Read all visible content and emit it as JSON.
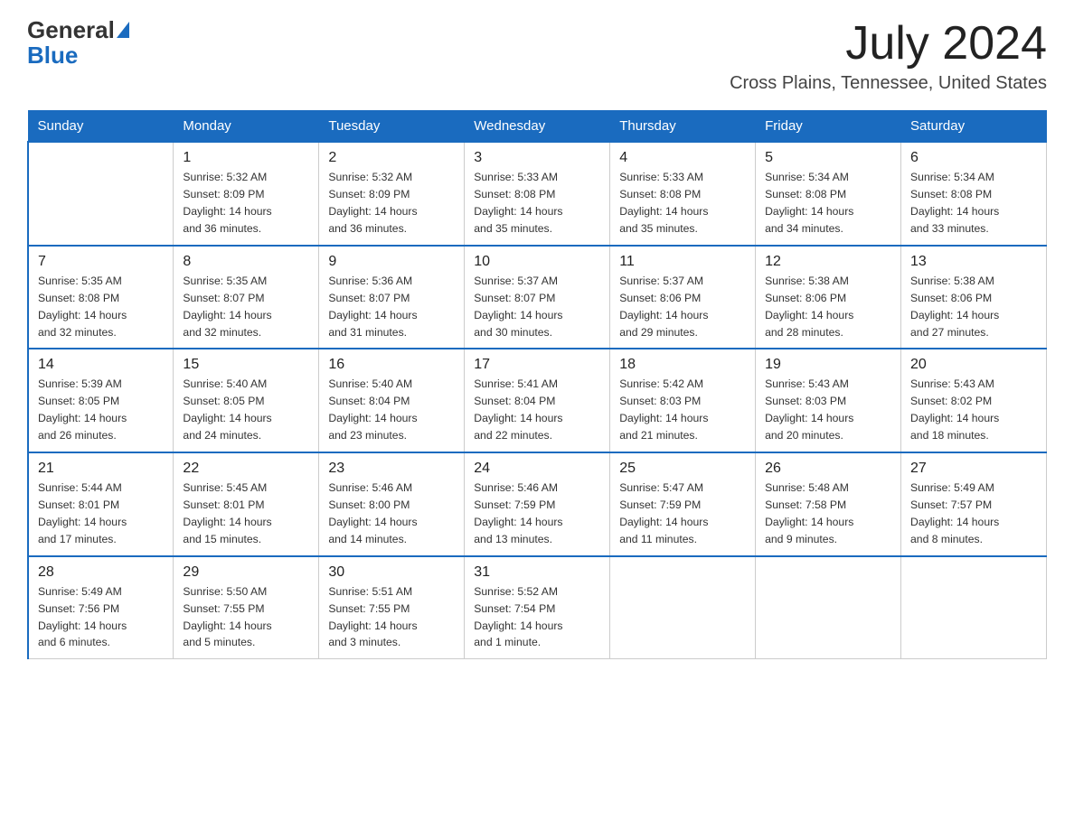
{
  "header": {
    "logo_general": "General",
    "logo_blue": "Blue",
    "month_title": "July 2024",
    "location": "Cross Plains, Tennessee, United States"
  },
  "days_of_week": [
    "Sunday",
    "Monday",
    "Tuesday",
    "Wednesday",
    "Thursday",
    "Friday",
    "Saturday"
  ],
  "weeks": [
    [
      {
        "day": "",
        "info": ""
      },
      {
        "day": "1",
        "info": "Sunrise: 5:32 AM\nSunset: 8:09 PM\nDaylight: 14 hours\nand 36 minutes."
      },
      {
        "day": "2",
        "info": "Sunrise: 5:32 AM\nSunset: 8:09 PM\nDaylight: 14 hours\nand 36 minutes."
      },
      {
        "day": "3",
        "info": "Sunrise: 5:33 AM\nSunset: 8:08 PM\nDaylight: 14 hours\nand 35 minutes."
      },
      {
        "day": "4",
        "info": "Sunrise: 5:33 AM\nSunset: 8:08 PM\nDaylight: 14 hours\nand 35 minutes."
      },
      {
        "day": "5",
        "info": "Sunrise: 5:34 AM\nSunset: 8:08 PM\nDaylight: 14 hours\nand 34 minutes."
      },
      {
        "day": "6",
        "info": "Sunrise: 5:34 AM\nSunset: 8:08 PM\nDaylight: 14 hours\nand 33 minutes."
      }
    ],
    [
      {
        "day": "7",
        "info": "Sunrise: 5:35 AM\nSunset: 8:08 PM\nDaylight: 14 hours\nand 32 minutes."
      },
      {
        "day": "8",
        "info": "Sunrise: 5:35 AM\nSunset: 8:07 PM\nDaylight: 14 hours\nand 32 minutes."
      },
      {
        "day": "9",
        "info": "Sunrise: 5:36 AM\nSunset: 8:07 PM\nDaylight: 14 hours\nand 31 minutes."
      },
      {
        "day": "10",
        "info": "Sunrise: 5:37 AM\nSunset: 8:07 PM\nDaylight: 14 hours\nand 30 minutes."
      },
      {
        "day": "11",
        "info": "Sunrise: 5:37 AM\nSunset: 8:06 PM\nDaylight: 14 hours\nand 29 minutes."
      },
      {
        "day": "12",
        "info": "Sunrise: 5:38 AM\nSunset: 8:06 PM\nDaylight: 14 hours\nand 28 minutes."
      },
      {
        "day": "13",
        "info": "Sunrise: 5:38 AM\nSunset: 8:06 PM\nDaylight: 14 hours\nand 27 minutes."
      }
    ],
    [
      {
        "day": "14",
        "info": "Sunrise: 5:39 AM\nSunset: 8:05 PM\nDaylight: 14 hours\nand 26 minutes."
      },
      {
        "day": "15",
        "info": "Sunrise: 5:40 AM\nSunset: 8:05 PM\nDaylight: 14 hours\nand 24 minutes."
      },
      {
        "day": "16",
        "info": "Sunrise: 5:40 AM\nSunset: 8:04 PM\nDaylight: 14 hours\nand 23 minutes."
      },
      {
        "day": "17",
        "info": "Sunrise: 5:41 AM\nSunset: 8:04 PM\nDaylight: 14 hours\nand 22 minutes."
      },
      {
        "day": "18",
        "info": "Sunrise: 5:42 AM\nSunset: 8:03 PM\nDaylight: 14 hours\nand 21 minutes."
      },
      {
        "day": "19",
        "info": "Sunrise: 5:43 AM\nSunset: 8:03 PM\nDaylight: 14 hours\nand 20 minutes."
      },
      {
        "day": "20",
        "info": "Sunrise: 5:43 AM\nSunset: 8:02 PM\nDaylight: 14 hours\nand 18 minutes."
      }
    ],
    [
      {
        "day": "21",
        "info": "Sunrise: 5:44 AM\nSunset: 8:01 PM\nDaylight: 14 hours\nand 17 minutes."
      },
      {
        "day": "22",
        "info": "Sunrise: 5:45 AM\nSunset: 8:01 PM\nDaylight: 14 hours\nand 15 minutes."
      },
      {
        "day": "23",
        "info": "Sunrise: 5:46 AM\nSunset: 8:00 PM\nDaylight: 14 hours\nand 14 minutes."
      },
      {
        "day": "24",
        "info": "Sunrise: 5:46 AM\nSunset: 7:59 PM\nDaylight: 14 hours\nand 13 minutes."
      },
      {
        "day": "25",
        "info": "Sunrise: 5:47 AM\nSunset: 7:59 PM\nDaylight: 14 hours\nand 11 minutes."
      },
      {
        "day": "26",
        "info": "Sunrise: 5:48 AM\nSunset: 7:58 PM\nDaylight: 14 hours\nand 9 minutes."
      },
      {
        "day": "27",
        "info": "Sunrise: 5:49 AM\nSunset: 7:57 PM\nDaylight: 14 hours\nand 8 minutes."
      }
    ],
    [
      {
        "day": "28",
        "info": "Sunrise: 5:49 AM\nSunset: 7:56 PM\nDaylight: 14 hours\nand 6 minutes."
      },
      {
        "day": "29",
        "info": "Sunrise: 5:50 AM\nSunset: 7:55 PM\nDaylight: 14 hours\nand 5 minutes."
      },
      {
        "day": "30",
        "info": "Sunrise: 5:51 AM\nSunset: 7:55 PM\nDaylight: 14 hours\nand 3 minutes."
      },
      {
        "day": "31",
        "info": "Sunrise: 5:52 AM\nSunset: 7:54 PM\nDaylight: 14 hours\nand 1 minute."
      },
      {
        "day": "",
        "info": ""
      },
      {
        "day": "",
        "info": ""
      },
      {
        "day": "",
        "info": ""
      }
    ]
  ]
}
